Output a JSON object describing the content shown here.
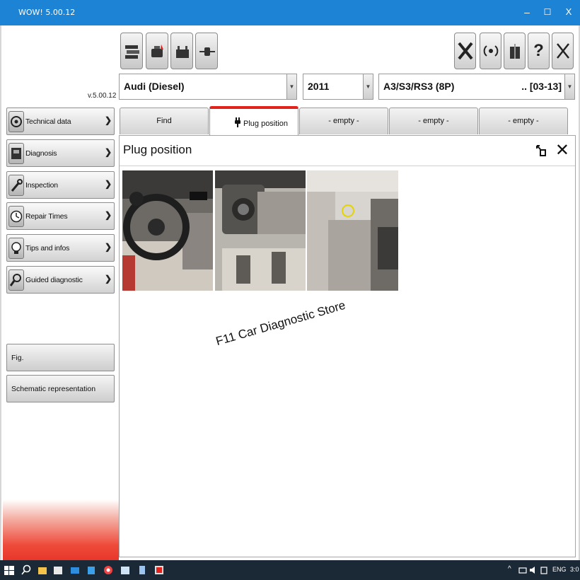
{
  "window": {
    "title": "WOW! 5.00.12",
    "controls": {
      "minimize": "–",
      "maximize": "☐",
      "close": "X"
    }
  },
  "version": "v.5.00.12",
  "toolbar": {
    "left_icons": [
      "car-list-icon",
      "engine-icon",
      "battery-icon",
      "plug-connector-icon"
    ],
    "right_buttons": [
      {
        "name": "tools-icon",
        "label": "X"
      },
      {
        "name": "wireless-icon",
        "label": "((·))"
      },
      {
        "name": "gift-icon",
        "label": "▮"
      },
      {
        "name": "help-icon",
        "label": "?"
      },
      {
        "name": "exit-icon",
        "label": "X"
      }
    ]
  },
  "selectors": {
    "make": "Audi (Diesel)",
    "year": "2011",
    "model": "A3/S3/RS3 (8P)",
    "model_range": ".. [03-13]"
  },
  "sidebar": {
    "items": [
      {
        "label": "Technical data",
        "icon": "engine-icon"
      },
      {
        "label": "Diagnosis",
        "icon": "diagnosis-icon"
      },
      {
        "label": "Inspection",
        "icon": "wrench-icon"
      },
      {
        "label": "Repair Times",
        "icon": "clock-icon"
      },
      {
        "label": "Tips and infos",
        "icon": "lightbulb-icon"
      },
      {
        "label": "Guided diagnostic",
        "icon": "magnifier-wrench-icon"
      }
    ],
    "bottom": [
      {
        "label": "Fig."
      },
      {
        "label": "Schematic representation"
      }
    ]
  },
  "tabs": [
    {
      "label": "Find",
      "active": false
    },
    {
      "label": "Plug position",
      "active": true
    },
    {
      "label": "- empty -",
      "active": false
    },
    {
      "label": "- empty -",
      "active": false
    },
    {
      "label": "- empty -",
      "active": false
    }
  ],
  "content": {
    "title": "Plug position",
    "photos": [
      "dashboard-steering-photo",
      "light-switch-panel-photo",
      "footwell-plug-photo"
    ],
    "watermark": "F11 Car Diagnostic Store"
  },
  "taskbar": {
    "tray": {
      "language": "ENG",
      "time": "3:0"
    }
  },
  "colors": {
    "titlebar": "#1d83d4",
    "active_tab_accent": "#e0231c",
    "taskbar": "#1b2836",
    "sidebar_fade": "#e8372a"
  }
}
